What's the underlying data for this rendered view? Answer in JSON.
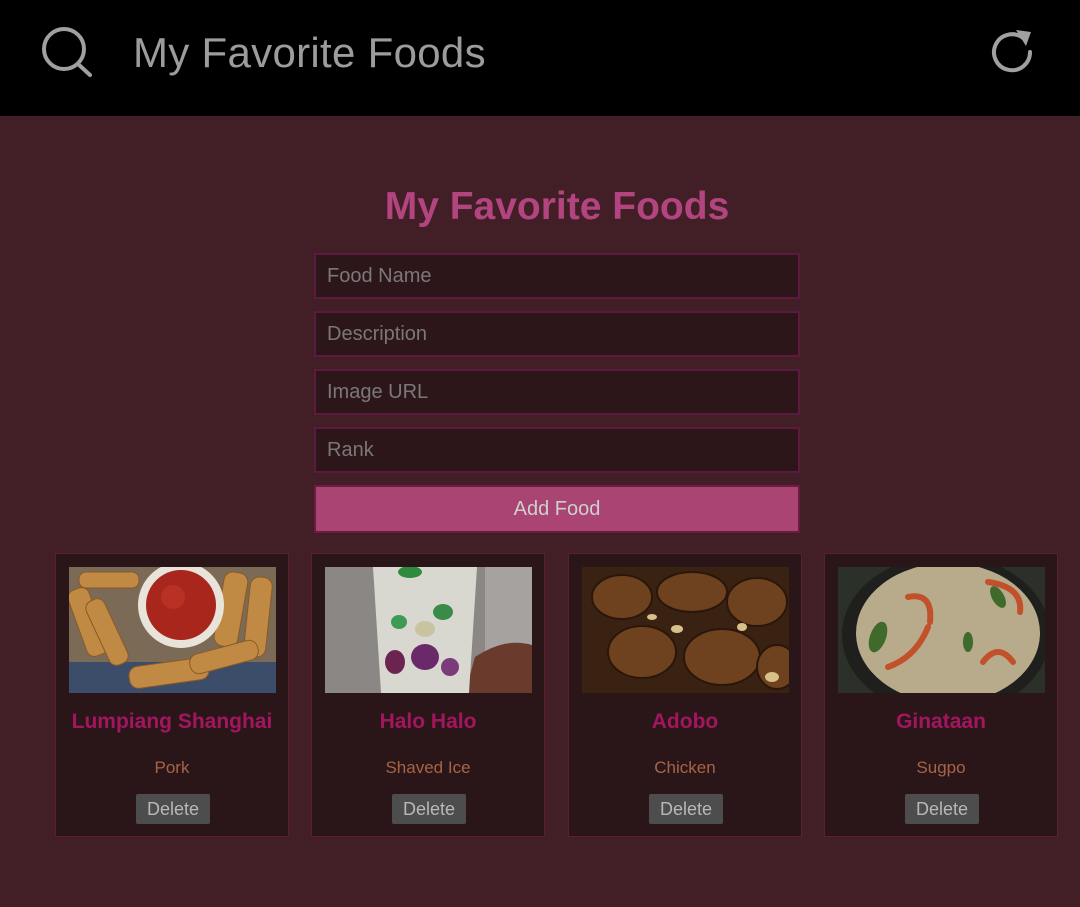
{
  "app_bar": {
    "title": "My Favorite Foods",
    "search_icon": "search-icon",
    "refresh_icon": "refresh-icon"
  },
  "main": {
    "heading": "My Favorite Foods",
    "form": {
      "food_name_placeholder": "Food Name",
      "description_placeholder": "Description",
      "image_url_placeholder": "Image URL",
      "rank_placeholder": "Rank",
      "add_button_label": "Add Food"
    },
    "foods": [
      {
        "name": "Lumpiang Shanghai",
        "description": "Pork",
        "delete_label": "Delete"
      },
      {
        "name": "Halo Halo",
        "description": "Shaved Ice",
        "delete_label": "Delete"
      },
      {
        "name": "Adobo",
        "description": "Chicken",
        "delete_label": "Delete"
      },
      {
        "name": "Ginataan",
        "description": "Sugpo",
        "delete_label": "Delete"
      }
    ]
  },
  "colors": {
    "background": "#421e26",
    "top_bar": "#000000",
    "accent": "#b2447f",
    "card_title": "#a3165f",
    "card_description": "#a66446",
    "card_background": "#2a1618"
  }
}
